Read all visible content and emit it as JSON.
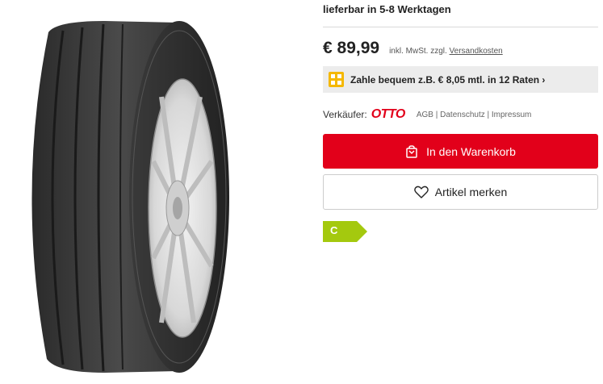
{
  "product": {
    "image_alt_icon": "tire-image"
  },
  "offer": {
    "delivery": "lieferbar in 5-8 Werktagen",
    "price": "€ 89,99",
    "price_note_prefix": "inkl. MwSt. zzgl. ",
    "shipping_link": "Versandkosten",
    "finance_text": "Zahle bequem z.B. € 8,05 mtl. in 12 Raten ›",
    "finance_icon": "installment-icon",
    "seller_label": "Verkäufer:",
    "seller_name": "OTTO",
    "seller_links": [
      "AGB",
      "Datenschutz",
      "Impressum"
    ],
    "seller_separator": " | ",
    "cart_button": "In den Warenkorb",
    "cart_icon": "shopping-bag-icon",
    "merken_button": "Artikel merken",
    "merken_icon": "heart-icon",
    "energy_class": "C",
    "colors": {
      "brand_red": "#e2001a",
      "energy_green": "#a4c90e",
      "finance_yellow": "#f5b800"
    }
  }
}
